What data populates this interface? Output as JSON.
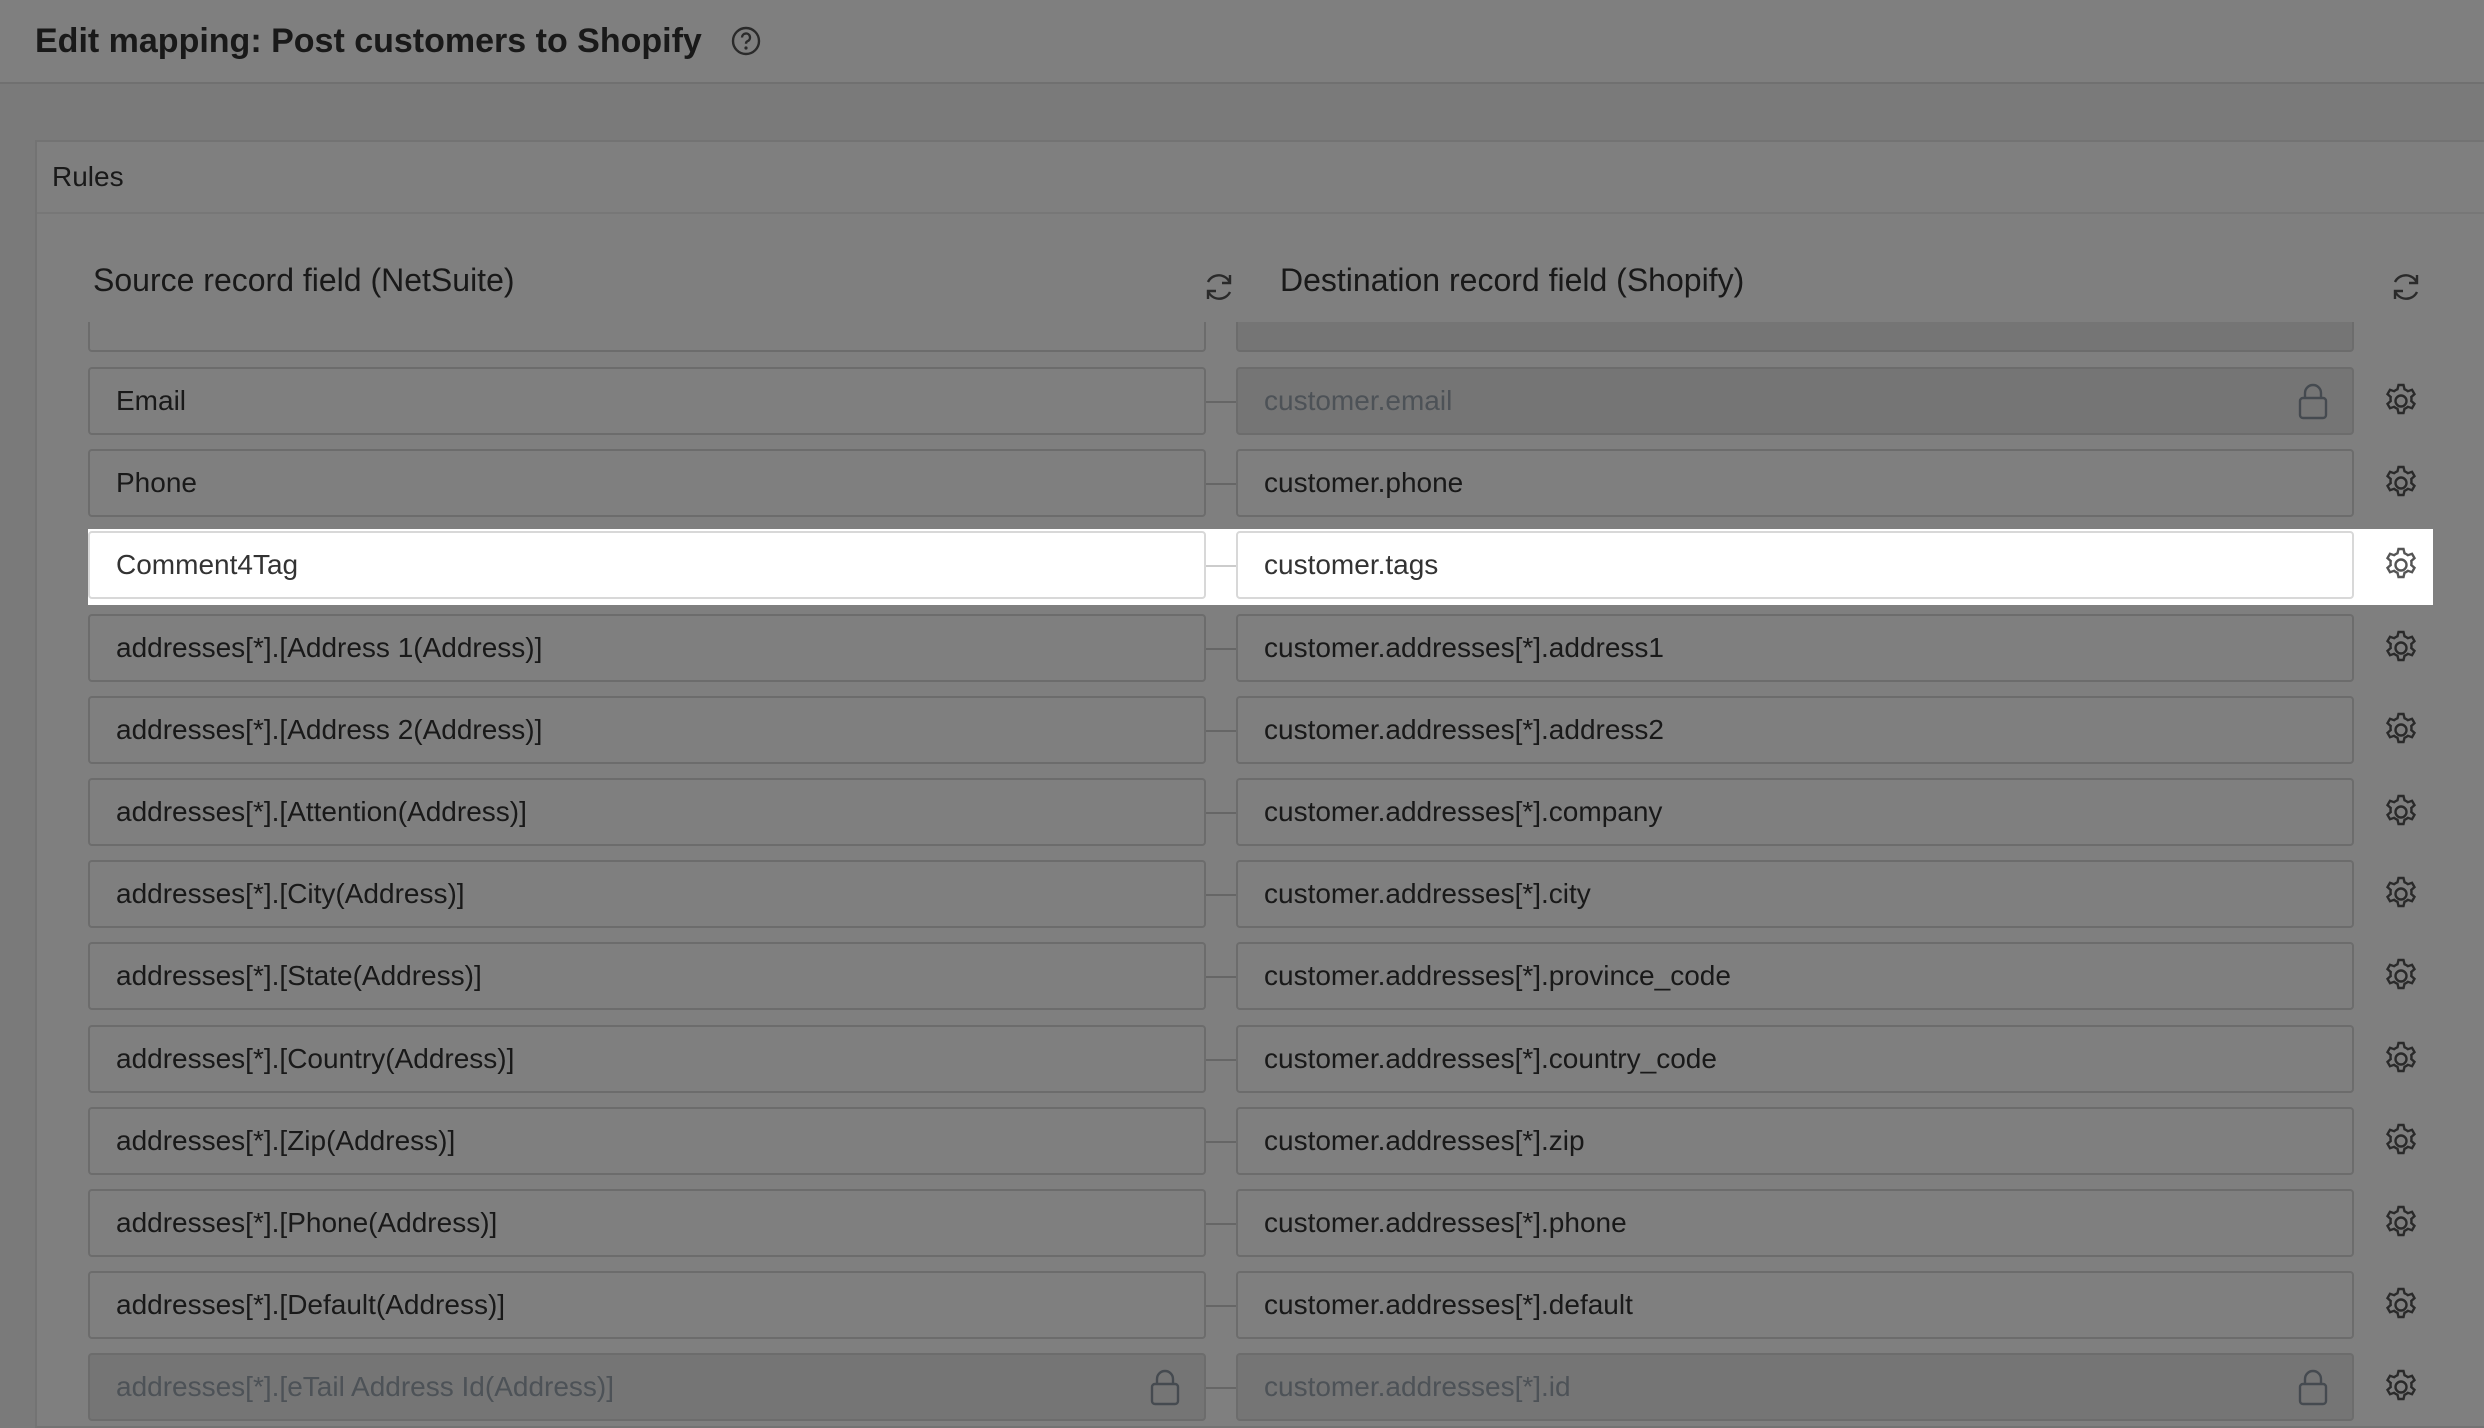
{
  "header": {
    "title": "Edit mapping: Post customers to Shopify"
  },
  "rules": {
    "title": "Rules",
    "source_heading": "Source record field (NetSuite)",
    "destination_heading": "Destination record field (Shopify)"
  },
  "rows": [
    {
      "source": "Email",
      "destination": "customer.email",
      "source_locked": false,
      "destination_locked": true
    },
    {
      "source": "Phone",
      "destination": "customer.phone",
      "source_locked": false,
      "destination_locked": false
    },
    {
      "source": "Comment4Tag",
      "destination": "customer.tags",
      "source_locked": false,
      "destination_locked": false,
      "highlighted": true
    },
    {
      "source": "addresses[*].[Address 1(Address)]",
      "destination": "customer.addresses[*].address1",
      "source_locked": false,
      "destination_locked": false
    },
    {
      "source": "addresses[*].[Address 2(Address)]",
      "destination": "customer.addresses[*].address2",
      "source_locked": false,
      "destination_locked": false
    },
    {
      "source": "addresses[*].[Attention(Address)]",
      "destination": "customer.addresses[*].company",
      "source_locked": false,
      "destination_locked": false
    },
    {
      "source": "addresses[*].[City(Address)]",
      "destination": "customer.addresses[*].city",
      "source_locked": false,
      "destination_locked": false
    },
    {
      "source": "addresses[*].[State(Address)]",
      "destination": "customer.addresses[*].province_code",
      "source_locked": false,
      "destination_locked": false
    },
    {
      "source": "addresses[*].[Country(Address)]",
      "destination": "customer.addresses[*].country_code",
      "source_locked": false,
      "destination_locked": false
    },
    {
      "source": "addresses[*].[Zip(Address)]",
      "destination": "customer.addresses[*].zip",
      "source_locked": false,
      "destination_locked": false
    },
    {
      "source": "addresses[*].[Phone(Address)]",
      "destination": "customer.addresses[*].phone",
      "source_locked": false,
      "destination_locked": false
    },
    {
      "source": "addresses[*].[Default(Address)]",
      "destination": "customer.addresses[*].default",
      "source_locked": false,
      "destination_locked": false
    },
    {
      "source": "addresses[*].[eTail Address Id(Address)]",
      "destination": "customer.addresses[*].id",
      "source_locked": true,
      "destination_locked": true
    }
  ]
}
